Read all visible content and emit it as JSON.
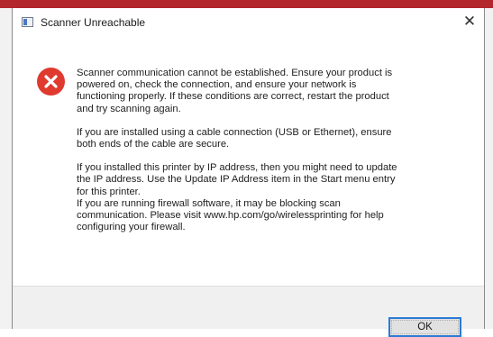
{
  "window": {
    "title": "Scanner Unreachable",
    "close_glyph": "✕",
    "app_icon": "app-window-icon"
  },
  "message": {
    "icon": "error-icon",
    "icon_color": "#e03a2f",
    "paragraphs": [
      "Scanner communication cannot be established.  Ensure your product is\npowered on, check the connection, and ensure your network is\nfunctioning properly.  If these conditions are correct, restart the product\nand try scanning again.",
      "If you are installed using a cable connection (USB or Ethernet), ensure\nboth ends of the cable are secure.",
      "If you installed this printer by IP address, then you might need to update\nthe IP address.  Use the Update IP Address item in the Start menu entry\nfor this printer.",
      "If you are running firewall software, it may be blocking scan\ncommunication.  Please visit www.hp.com/go/wirelessprinting for help\nconfiguring your firewall."
    ]
  },
  "footer": {
    "ok_label": "OK",
    "accent": "#2b7bd4"
  }
}
